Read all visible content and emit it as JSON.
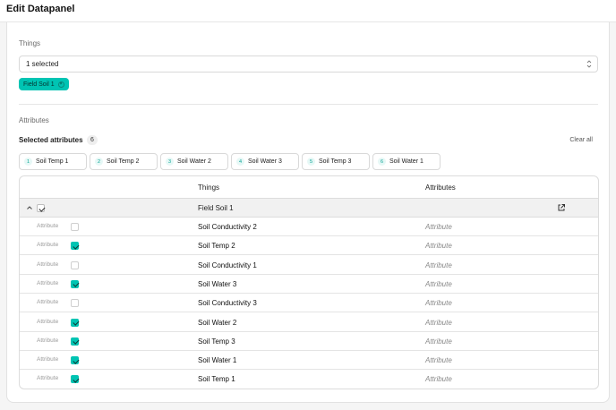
{
  "header": {
    "title": "Edit Datapanel"
  },
  "things": {
    "label": "Things",
    "select_value": "1 selected",
    "selected_chips": [
      {
        "label": "Field Soil 1"
      }
    ]
  },
  "attributes": {
    "label": "Attributes",
    "selected_label": "Selected attributes",
    "selected_count": "6",
    "clear_all": "Clear all",
    "chips": [
      {
        "num": "1",
        "label": "Soil Temp 1"
      },
      {
        "num": "2",
        "label": "Soil Temp 2"
      },
      {
        "num": "3",
        "label": "Soil Water 2"
      },
      {
        "num": "4",
        "label": "Soil Water 3"
      },
      {
        "num": "5",
        "label": "Soil Temp 3"
      },
      {
        "num": "6",
        "label": "Soil Water 1"
      }
    ]
  },
  "table": {
    "columns": {
      "things": "Things",
      "attributes": "Attributes"
    },
    "group": {
      "name": "Field Soil 1",
      "checked": true
    },
    "rows": [
      {
        "tag": "Attribute",
        "checked": false,
        "thing": "Soil Conductivity 2",
        "attribute": "Attribute"
      },
      {
        "tag": "Attribute",
        "checked": true,
        "thing": "Soil Temp 2",
        "attribute": "Attribute"
      },
      {
        "tag": "Attribute",
        "checked": false,
        "thing": "Soil Conductivity 1",
        "attribute": "Attribute"
      },
      {
        "tag": "Attribute",
        "checked": true,
        "thing": "Soil Water 3",
        "attribute": "Attribute"
      },
      {
        "tag": "Attribute",
        "checked": false,
        "thing": "Soil Conductivity 3",
        "attribute": "Attribute"
      },
      {
        "tag": "Attribute",
        "checked": true,
        "thing": "Soil Water 2",
        "attribute": "Attribute"
      },
      {
        "tag": "Attribute",
        "checked": true,
        "thing": "Soil Temp 3",
        "attribute": "Attribute"
      },
      {
        "tag": "Attribute",
        "checked": true,
        "thing": "Soil Water 1",
        "attribute": "Attribute"
      },
      {
        "tag": "Attribute",
        "checked": true,
        "thing": "Soil Temp 1",
        "attribute": "Attribute"
      }
    ]
  },
  "icons": {
    "select_chevron": "chevron-up-down-icon",
    "chip_remove": "close-circle-icon",
    "collapse": "chevron-up-icon",
    "open_external": "external-link-icon"
  },
  "colors": {
    "accent": "#00c4b3",
    "accent_text": "#05302c"
  }
}
